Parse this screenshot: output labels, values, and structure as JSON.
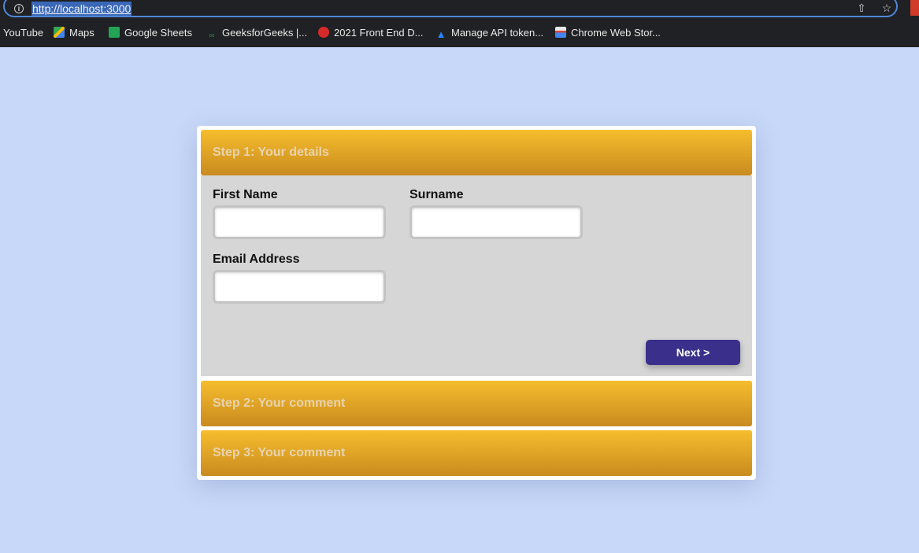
{
  "browser": {
    "url": "http://localhost:3000",
    "bookmarks": [
      {
        "label": "YouTube",
        "icon": "youtube-icon"
      },
      {
        "label": "Maps",
        "icon": "maps-icon"
      },
      {
        "label": "Google Sheets",
        "icon": "sheets-icon"
      },
      {
        "label": "GeeksforGeeks |...",
        "icon": "geeksforgeeks-icon"
      },
      {
        "label": "2021 Front End D...",
        "icon": "frontend-icon"
      },
      {
        "label": "Manage API token...",
        "icon": "atlassian-icon"
      },
      {
        "label": "Chrome Web Stor...",
        "icon": "webstore-icon"
      }
    ]
  },
  "form": {
    "step1": {
      "title": "Step 1: Your details",
      "first_name_label": "First Name",
      "first_name_value": "",
      "surname_label": "Surname",
      "surname_value": "",
      "email_label": "Email Address",
      "email_value": "",
      "next_label": "Next >"
    },
    "step2": {
      "title": "Step 2: Your comment"
    },
    "step3": {
      "title": "Step 3: Your comment"
    }
  },
  "colors": {
    "page_background": "#c8d8f8",
    "header_gradient_top": "#f6bd2d",
    "header_gradient_bottom": "#c98b1f",
    "panel_background": "#d6d6d6",
    "button": "#3a2f8a"
  }
}
